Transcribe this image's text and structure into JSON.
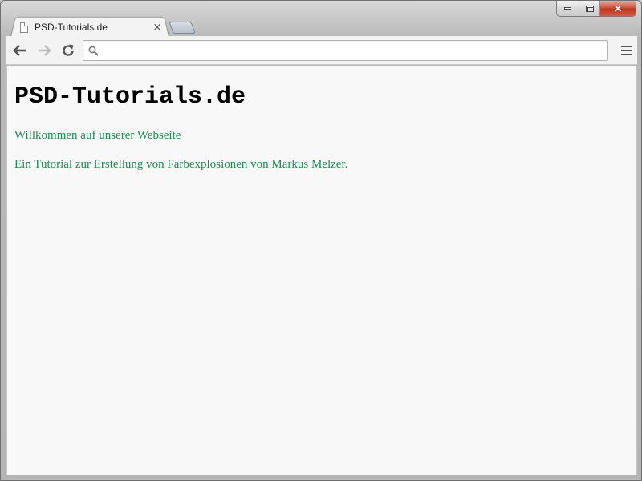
{
  "window": {
    "minimize_glyph": "",
    "maximize_glyph": "",
    "close_glyph": "×"
  },
  "tabs": [
    {
      "title": "PSD-Tutorials.de",
      "icon": "page-icon",
      "close_glyph": "×"
    }
  ],
  "toolbar": {
    "back_icon": "back-arrow-icon",
    "forward_icon": "forward-arrow-icon",
    "reload_icon": "reload-icon",
    "omnibox": {
      "value": "",
      "placeholder": "",
      "icon": "search-icon"
    },
    "menu_icon": "hamburger-menu-icon"
  },
  "page": {
    "heading": "PSD-Tutorials.de",
    "paragraphs": [
      "Willkommen auf unserer Webseite",
      "Ein Tutorial zur Erstellung von Farbexplosionen von Markus Melzer."
    ],
    "text_color": "#1a8f52"
  }
}
